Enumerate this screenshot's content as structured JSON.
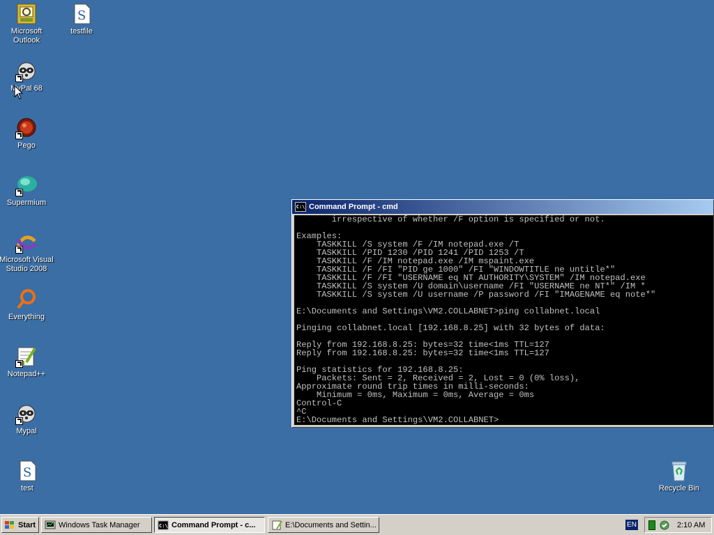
{
  "desktop": {
    "icons": [
      {
        "label": "Microsoft\nOutlook"
      },
      {
        "label": "testfile"
      },
      {
        "label": "MyPal 68"
      },
      {
        "label": "Pego"
      },
      {
        "label": "Supermium"
      },
      {
        "label": "Microsoft Visual\nStudio 2008"
      },
      {
        "label": "Everything"
      },
      {
        "label": "Notepad++"
      },
      {
        "label": "Mypal"
      },
      {
        "label": "test"
      },
      {
        "label": "Recycle Bin"
      }
    ]
  },
  "cmd": {
    "title": "Command Prompt - cmd",
    "lines": [
      "       irrespective of whether /F option is specified or not.",
      "",
      "Examples:",
      "    TASKKILL /S system /F /IM notepad.exe /T",
      "    TASKKILL /PID 1230 /PID 1241 /PID 1253 /T",
      "    TASKKILL /F /IM notepad.exe /IM mspaint.exe",
      "    TASKKILL /F /FI \"PID ge 1000\" /FI \"WINDOWTITLE ne untitle*\"",
      "    TASKKILL /F /FI \"USERNAME eq NT AUTHORITY\\SYSTEM\" /IM notepad.exe",
      "    TASKKILL /S system /U domain\\username /FI \"USERNAME ne NT*\" /IM *",
      "    TASKKILL /S system /U username /P password /FI \"IMAGENAME eq note*\"",
      "",
      "E:\\Documents and Settings\\VM2.COLLABNET>ping collabnet.local",
      "",
      "Pinging collabnet.local [192.168.8.25] with 32 bytes of data:",
      "",
      "Reply from 192.168.8.25: bytes=32 time<1ms TTL=127",
      "Reply from 192.168.8.25: bytes=32 time<1ms TTL=127",
      "",
      "Ping statistics for 192.168.8.25:",
      "    Packets: Sent = 2, Received = 2, Lost = 0 (0% loss),",
      "Approximate round trip times in milli-seconds:",
      "    Minimum = 0ms, Maximum = 0ms, Average = 0ms",
      "Control-C",
      "^C",
      "E:\\Documents and Settings\\VM2.COLLABNET>"
    ]
  },
  "taskbar": {
    "start_label": "Start",
    "tasks": [
      {
        "label": "Windows Task Manager"
      },
      {
        "label": "Command Prompt - c..."
      },
      {
        "label": "E:\\Documents and Settin..."
      }
    ],
    "lang": "EN",
    "clock": "2:10 AM"
  }
}
